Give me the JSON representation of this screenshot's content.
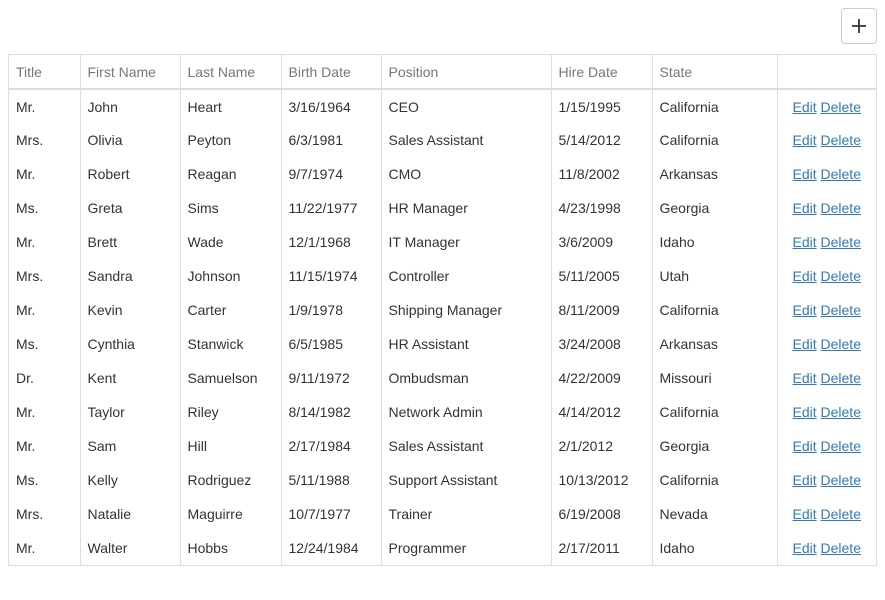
{
  "toolbar": {
    "add_icon": "plus-icon"
  },
  "table": {
    "columns": [
      "Title",
      "First Name",
      "Last Name",
      "Birth Date",
      "Position",
      "Hire Date",
      "State",
      ""
    ],
    "edit_label": "Edit",
    "delete_label": "Delete",
    "rows": [
      [
        "Mr.",
        "John",
        "Heart",
        "3/16/1964",
        "CEO",
        "1/15/1995",
        "California"
      ],
      [
        "Mrs.",
        "Olivia",
        "Peyton",
        "6/3/1981",
        "Sales Assistant",
        "5/14/2012",
        "California"
      ],
      [
        "Mr.",
        "Robert",
        "Reagan",
        "9/7/1974",
        "CMO",
        "11/8/2002",
        "Arkansas"
      ],
      [
        "Ms.",
        "Greta",
        "Sims",
        "11/22/1977",
        "HR Manager",
        "4/23/1998",
        "Georgia"
      ],
      [
        "Mr.",
        "Brett",
        "Wade",
        "12/1/1968",
        "IT Manager",
        "3/6/2009",
        "Idaho"
      ],
      [
        "Mrs.",
        "Sandra",
        "Johnson",
        "11/15/1974",
        "Controller",
        "5/11/2005",
        "Utah"
      ],
      [
        "Mr.",
        "Kevin",
        "Carter",
        "1/9/1978",
        "Shipping Manager",
        "8/11/2009",
        "California"
      ],
      [
        "Ms.",
        "Cynthia",
        "Stanwick",
        "6/5/1985",
        "HR Assistant",
        "3/24/2008",
        "Arkansas"
      ],
      [
        "Dr.",
        "Kent",
        "Samuelson",
        "9/11/1972",
        "Ombudsman",
        "4/22/2009",
        "Missouri"
      ],
      [
        "Mr.",
        "Taylor",
        "Riley",
        "8/14/1982",
        "Network Admin",
        "4/14/2012",
        "California"
      ],
      [
        "Mr.",
        "Sam",
        "Hill",
        "2/17/1984",
        "Sales Assistant",
        "2/1/2012",
        "Georgia"
      ],
      [
        "Ms.",
        "Kelly",
        "Rodriguez",
        "5/11/1988",
        "Support Assistant",
        "10/13/2012",
        "California"
      ],
      [
        "Mrs.",
        "Natalie",
        "Maguirre",
        "10/7/1977",
        "Trainer",
        "6/19/2008",
        "Nevada"
      ],
      [
        "Mr.",
        "Walter",
        "Hobbs",
        "12/24/1984",
        "Programmer",
        "2/17/2011",
        "Idaho"
      ]
    ]
  },
  "colors": {
    "link": "#337ab7",
    "border": "#dddddd",
    "header_text": "#777777"
  }
}
